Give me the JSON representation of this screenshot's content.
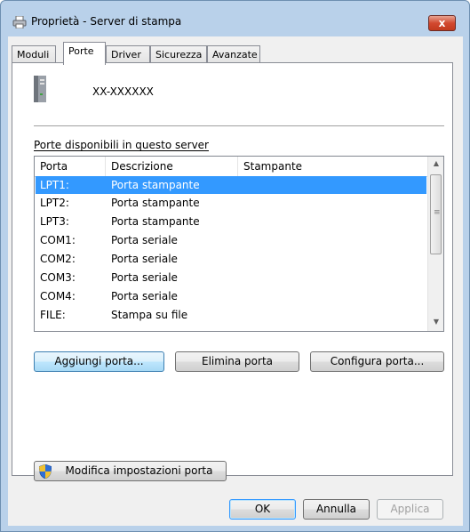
{
  "window": {
    "title": "Proprietà - Server di stampa",
    "close_glyph": "x"
  },
  "tabs": [
    {
      "label": "Moduli",
      "active": false
    },
    {
      "label": "Porte",
      "active": true
    },
    {
      "label": "Driver",
      "active": false
    },
    {
      "label": "Sicurezza",
      "active": false
    },
    {
      "label": "Avanzate",
      "active": false
    }
  ],
  "server": {
    "name": "XX-XXXXXX",
    "icon": "server-icon"
  },
  "ports": {
    "label": "Porte disponibili in questo server",
    "columns": [
      "Porta",
      "Descrizione",
      "Stampante"
    ],
    "rows": [
      {
        "port": "LPT1:",
        "description": "Porta stampante",
        "printer": "",
        "selected": true
      },
      {
        "port": "LPT2:",
        "description": "Porta stampante",
        "printer": ""
      },
      {
        "port": "LPT3:",
        "description": "Porta stampante",
        "printer": ""
      },
      {
        "port": "COM1:",
        "description": "Porta seriale",
        "printer": ""
      },
      {
        "port": "COM2:",
        "description": "Porta seriale",
        "printer": ""
      },
      {
        "port": "COM3:",
        "description": "Porta seriale",
        "printer": ""
      },
      {
        "port": "COM4:",
        "description": "Porta seriale",
        "printer": ""
      },
      {
        "port": "FILE:",
        "description": "Stampa su file",
        "printer": ""
      }
    ]
  },
  "actions": {
    "add_port": "Aggiungi porta...",
    "delete_port": "Elimina porta",
    "configure_port": "Configura porta...",
    "change_settings": "Modifica impostazioni porta"
  },
  "dialog_buttons": {
    "ok": "OK",
    "cancel": "Annulla",
    "apply": "Applica"
  },
  "colors": {
    "selection": "#3399ff",
    "frame": "#b9d1ea",
    "close": "#c8442b"
  }
}
